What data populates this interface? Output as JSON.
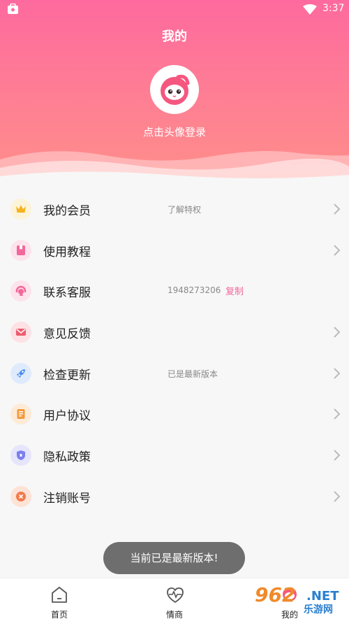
{
  "statusbar": {
    "time": "3:37"
  },
  "header": {
    "title": "我的",
    "login_text": "点击头像登录"
  },
  "menu": [
    {
      "label": "我的会员",
      "value": "了解特权",
      "action": "",
      "icon": "crown-icon",
      "color": "#f5b31f"
    },
    {
      "label": "使用教程",
      "value": "",
      "action": "",
      "icon": "book-icon",
      "color": "#f2689a"
    },
    {
      "label": "联系客服",
      "value": "1948273206",
      "action": "复制",
      "icon": "headset-icon",
      "color": "#f2689a"
    },
    {
      "label": "意见反馈",
      "value": "",
      "action": "",
      "icon": "mail-icon",
      "color": "#ee5c6e"
    },
    {
      "label": "检查更新",
      "value": "已是最新版本",
      "action": "",
      "icon": "rocket-icon",
      "color": "#4a8df0"
    },
    {
      "label": "用户协议",
      "value": "",
      "action": "",
      "icon": "document-icon",
      "color": "#f29a3c"
    },
    {
      "label": "隐私政策",
      "value": "",
      "action": "",
      "icon": "shield-icon",
      "color": "#7b7ff0"
    },
    {
      "label": "注销账号",
      "value": "",
      "action": "",
      "icon": "close-icon",
      "color": "#f07a4a"
    }
  ],
  "toast": {
    "text": "当前已是最新版本!"
  },
  "tabbar": {
    "tabs": [
      {
        "label": "首页",
        "icon": "home-icon"
      },
      {
        "label": "情商",
        "icon": "heartbeat-icon"
      },
      {
        "label": "我的",
        "icon": "profile-icon"
      }
    ]
  },
  "watermark": {
    "number": "962",
    "suffix": ".NET",
    "site": "乐游网"
  }
}
